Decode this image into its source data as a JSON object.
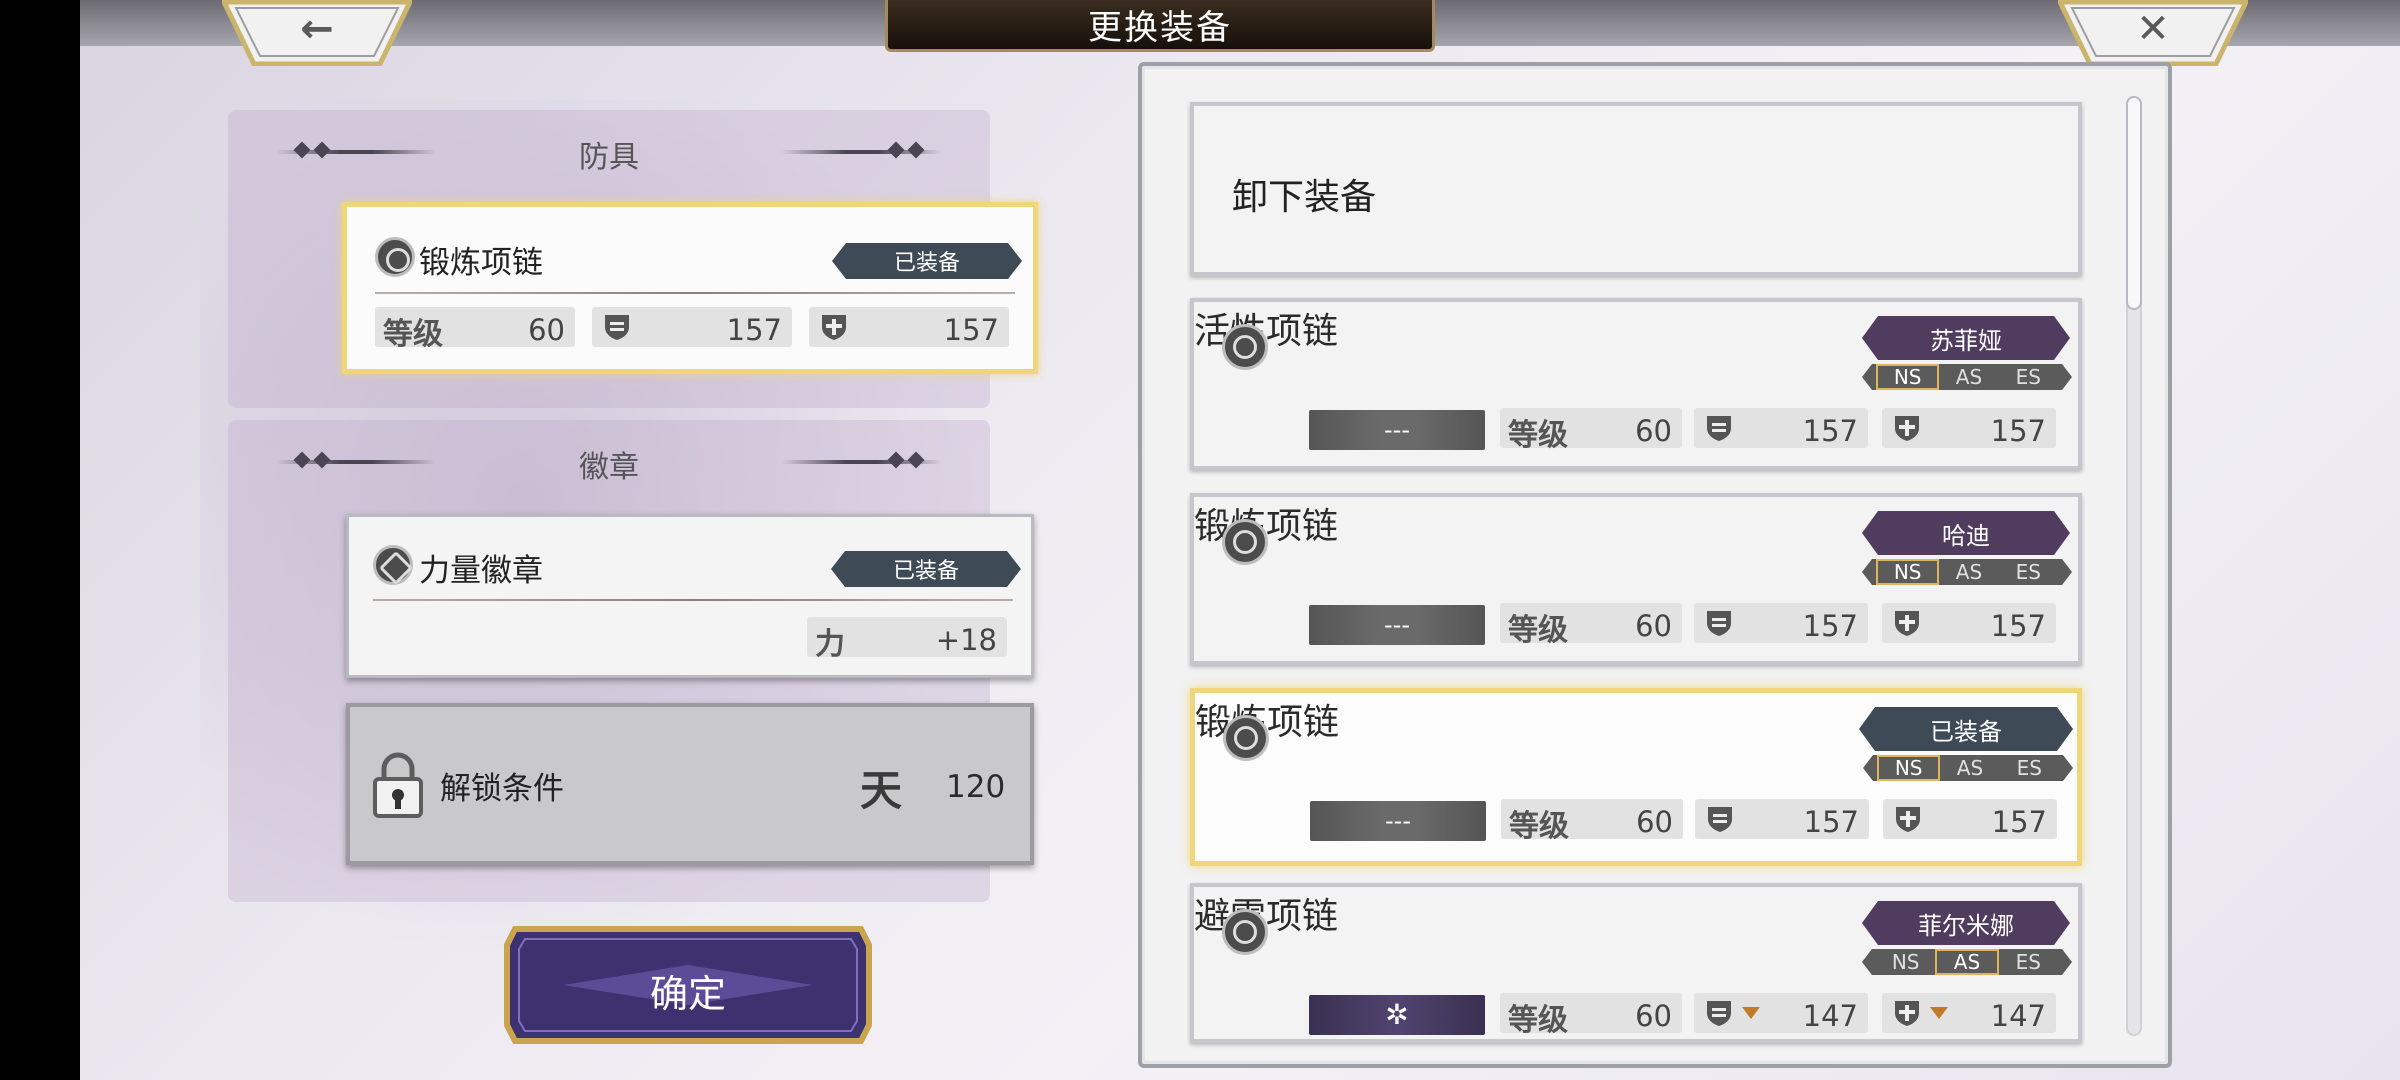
{
  "header": {
    "title": "更换装备",
    "back_glyph": "←",
    "close_glyph": "✕"
  },
  "left": {
    "armor_section": "防具",
    "armor_item": {
      "name": "锻炼项链",
      "status": "已装备",
      "level_label": "等级",
      "level": "60",
      "def1": "157",
      "def2": "157"
    },
    "badge_section": "徽章",
    "badge_item": {
      "name": "力量徽章",
      "status": "已装备",
      "stat_label": "力",
      "stat_value": "+18"
    },
    "locked": {
      "label": "解锁条件",
      "req_icon": "天",
      "req_value": "120"
    },
    "confirm_label": "确定"
  },
  "right": {
    "unequip_label": "卸下装备",
    "items": [
      {
        "name": "活性项链",
        "owner": "苏菲娅",
        "ns": [
          "NS",
          "AS",
          "ES"
        ],
        "ns_on": "NS",
        "slot": "---",
        "level_label": "等级",
        "level": "60",
        "def1": "157",
        "def2": "157"
      },
      {
        "name": "锻炼项链",
        "owner": "哈迪",
        "ns": [
          "NS",
          "AS",
          "ES"
        ],
        "ns_on": "NS",
        "slot": "---",
        "level_label": "等级",
        "level": "60",
        "def1": "157",
        "def2": "157"
      },
      {
        "name": "锻炼项链",
        "owner": "已装备",
        "ns": [
          "NS",
          "AS",
          "ES"
        ],
        "ns_on": "NS",
        "slot": "---",
        "level_label": "等级",
        "level": "60",
        "def1": "157",
        "def2": "157"
      },
      {
        "name": "避雷项链",
        "owner": "菲尔米娜",
        "ns": [
          "NS",
          "AS",
          "ES"
        ],
        "ns_on": "AS",
        "slot": "✲",
        "level_label": "等级",
        "level": "60",
        "def1": "147",
        "def2": "147"
      }
    ]
  },
  "colors": {
    "owner_tag": "#4f3c5e",
    "equipped_tag": "#3e4a55",
    "gold_border": "#f0d67a",
    "confirm": "#3d3170"
  }
}
